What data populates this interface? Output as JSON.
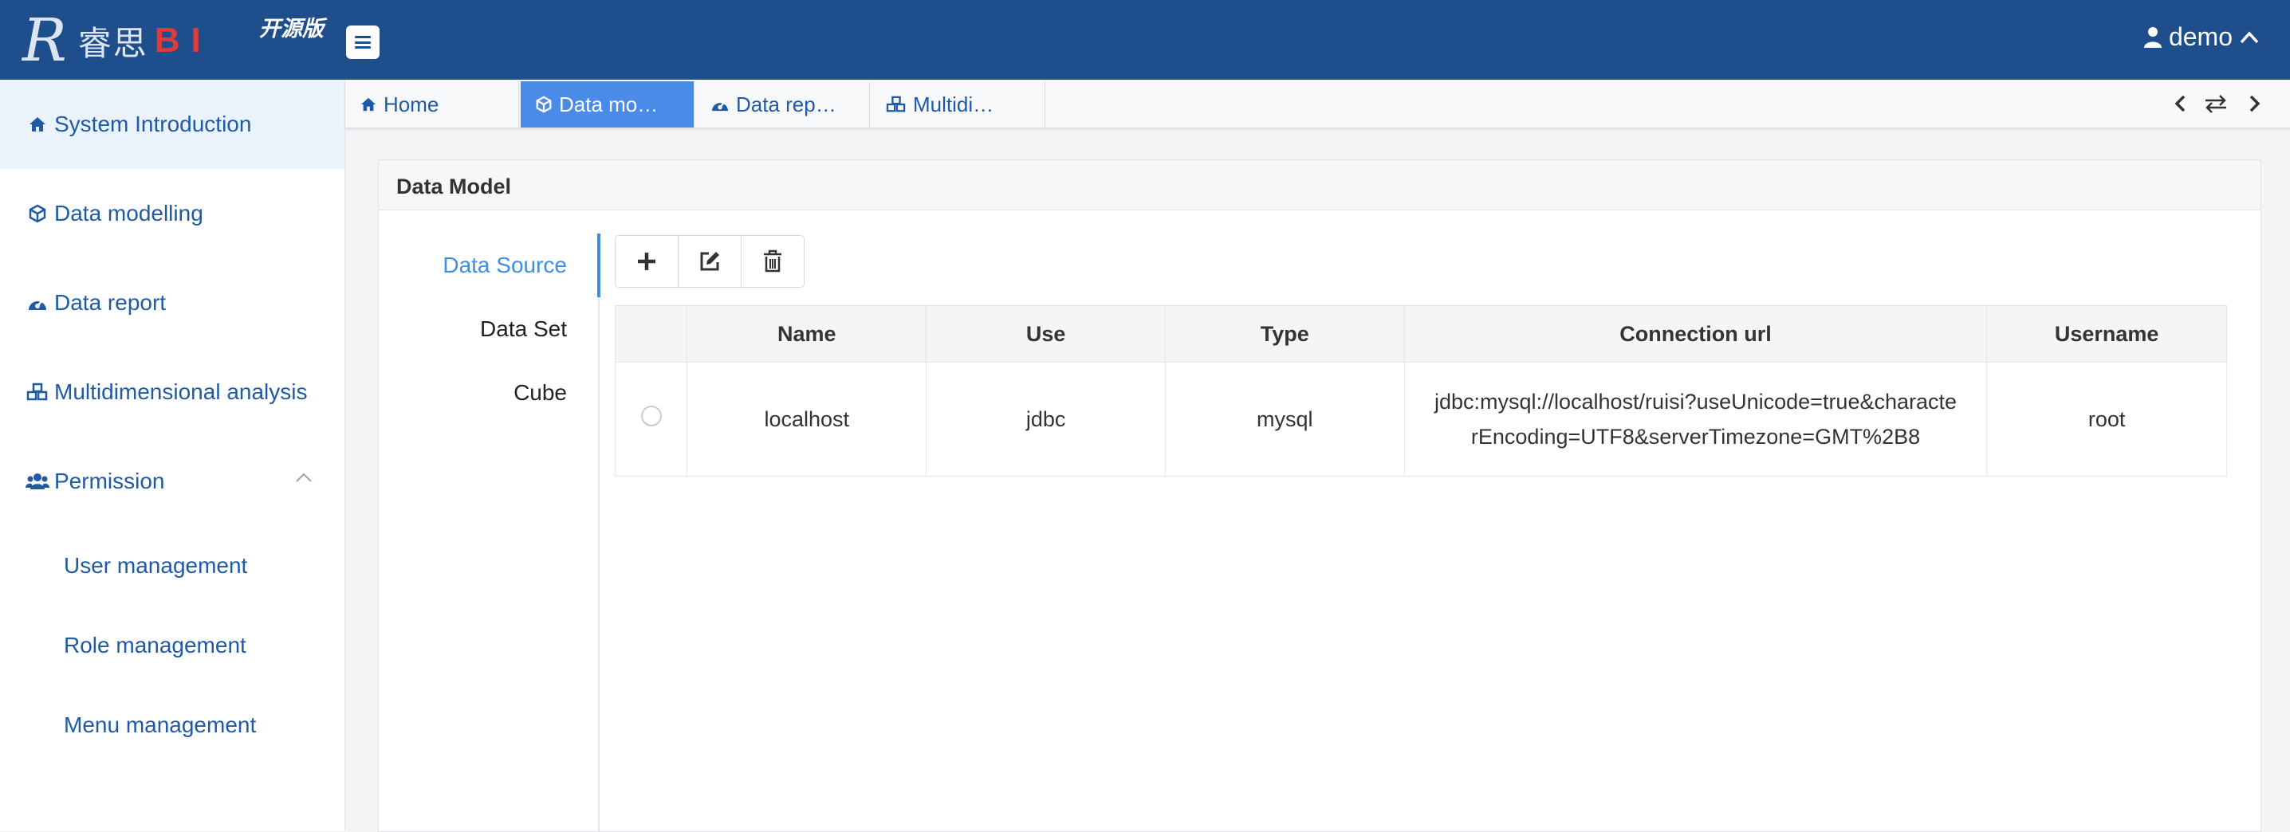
{
  "header": {
    "logo_letter": "R",
    "logo_name": "睿思",
    "logo_bi": "BI",
    "edition": "开源版",
    "user_name": "demo"
  },
  "sidebar": {
    "items": [
      {
        "label": "System Introduction",
        "icon": "home-icon"
      },
      {
        "label": "Data modelling",
        "icon": "cube-icon"
      },
      {
        "label": "Data report",
        "icon": "dashboard-icon"
      },
      {
        "label": "Multidimensional analysis",
        "icon": "cubes-icon"
      },
      {
        "label": "Permission",
        "icon": "users-icon"
      }
    ],
    "permission_children": [
      "User management",
      "Role management",
      "Menu management"
    ]
  },
  "tabs": [
    {
      "label": "Home",
      "icon": "home-icon"
    },
    {
      "label": "Data mo…",
      "icon": "cube-icon"
    },
    {
      "label": "Data rep…",
      "icon": "dashboard-icon"
    },
    {
      "label": "Multidi…",
      "icon": "cubes-icon"
    }
  ],
  "panel": {
    "title": "Data Model",
    "vtabs": [
      "Data Source",
      "Data Set",
      "Cube"
    ],
    "toolbar": [
      "add-icon",
      "edit-icon",
      "delete-icon"
    ],
    "table": {
      "headers": [
        "Name",
        "Use",
        "Type",
        "Connection url",
        "Username"
      ],
      "rows": [
        {
          "name": "localhost",
          "use": "jdbc",
          "type": "mysql",
          "url_line1": "jdbc:mysql://localhost/ruisi?useUnicode=true&characte",
          "url_line2": "rEncoding=UTF8&serverTimezone=GMT%2B8",
          "username": "root"
        }
      ]
    }
  },
  "colors": {
    "header": "#1f4e8c",
    "accent": "#3d8ee4",
    "active_tab": "#4b8be8",
    "link": "#1f5aa6",
    "logo_bi": "#e03b3b"
  }
}
